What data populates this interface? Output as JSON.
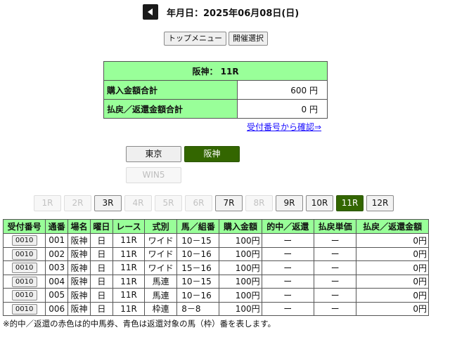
{
  "header": {
    "back_icon": "back-arrow-icon",
    "date_text": "年月日：2025年06月08日(日)"
  },
  "menu": {
    "top_menu_label": "トップメニュー",
    "venue_select_label": "開催選択"
  },
  "summary": {
    "title": "阪神： 11R",
    "purchase_label": "購入金額合計",
    "purchase_value": "600 円",
    "refund_label": "払戻／返還金額合計",
    "refund_value": "0 円"
  },
  "confirm_link": "受付番号から確認⇒",
  "venues": [
    {
      "label": "東京",
      "state": "normal"
    },
    {
      "label": "阪神",
      "state": "active"
    }
  ],
  "win5_label": "WIN5",
  "races": [
    {
      "label": "1R",
      "state": "disabled"
    },
    {
      "label": "2R",
      "state": "disabled"
    },
    {
      "label": "3R",
      "state": "normal"
    },
    {
      "label": "4R",
      "state": "disabled"
    },
    {
      "label": "5R",
      "state": "disabled"
    },
    {
      "label": "6R",
      "state": "disabled"
    },
    {
      "label": "7R",
      "state": "normal"
    },
    {
      "label": "8R",
      "state": "disabled"
    },
    {
      "label": "9R",
      "state": "normal"
    },
    {
      "label": "10R",
      "state": "normal"
    },
    {
      "label": "11R",
      "state": "active"
    },
    {
      "label": "12R",
      "state": "normal"
    }
  ],
  "table": {
    "headers": [
      "受付番号",
      "通番",
      "場名",
      "曜日",
      "レース",
      "式別",
      "馬／組番",
      "購入金額",
      "的中／返還",
      "払戻単価",
      "払戻／返還金額"
    ],
    "rows": [
      [
        "0010",
        "001",
        "阪神",
        "日",
        "11R",
        "ワイド",
        "10－15",
        "100円",
        "ー",
        "ー",
        "0円"
      ],
      [
        "0010",
        "002",
        "阪神",
        "日",
        "11R",
        "ワイド",
        "10－16",
        "100円",
        "ー",
        "ー",
        "0円"
      ],
      [
        "0010",
        "003",
        "阪神",
        "日",
        "11R",
        "ワイド",
        "15－16",
        "100円",
        "ー",
        "ー",
        "0円"
      ],
      [
        "0010",
        "004",
        "阪神",
        "日",
        "11R",
        "馬連",
        "10－15",
        "100円",
        "ー",
        "ー",
        "0円"
      ],
      [
        "0010",
        "005",
        "阪神",
        "日",
        "11R",
        "馬連",
        "10－16",
        "100円",
        "ー",
        "ー",
        "0円"
      ],
      [
        "0010",
        "006",
        "阪神",
        "日",
        "11R",
        "枠連",
        "8－8",
        "100円",
        "ー",
        "ー",
        "0円"
      ]
    ]
  },
  "note": "※的中／返還の赤色は的中馬券、青色は返還対象の馬（枠）番を表します。",
  "colors": {
    "accent_green": "#336600",
    "header_green": "#99ff99",
    "link_blue": "#1a0dff"
  }
}
